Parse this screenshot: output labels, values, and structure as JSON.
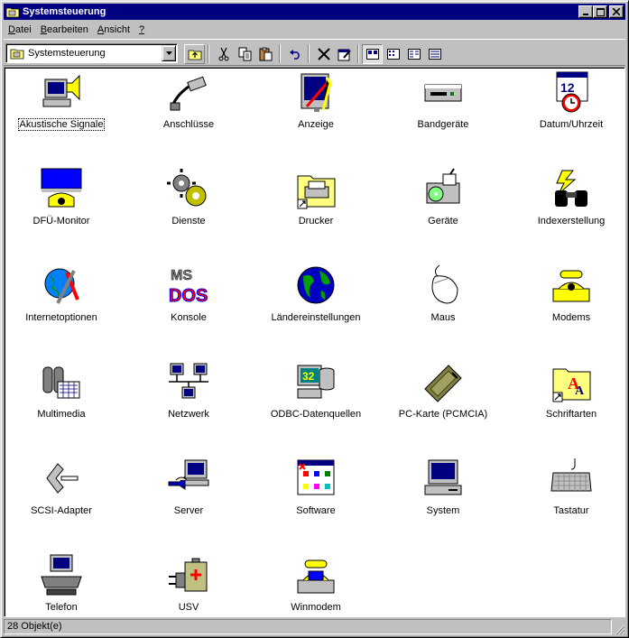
{
  "window": {
    "title": "Systemsteuerung"
  },
  "menu": [
    {
      "accel": "D",
      "rest": "atei"
    },
    {
      "accel": "B",
      "rest": "earbeiten"
    },
    {
      "accel": "A",
      "rest": "nsicht"
    },
    {
      "accel": "?",
      "rest": ""
    }
  ],
  "address": {
    "value": "Systemsteuerung"
  },
  "toolbar_buttons": [
    "up-folder",
    "cut",
    "copy",
    "paste",
    "undo",
    "delete",
    "properties",
    "large-icons",
    "small-icons",
    "list",
    "details"
  ],
  "items": [
    {
      "label": "Akustische Signale",
      "icon": "speaker-computer-icon"
    },
    {
      "label": "Anschlüsse",
      "icon": "port-cable-icon"
    },
    {
      "label": "Anzeige",
      "icon": "display-icon"
    },
    {
      "label": "Bandgeräte",
      "icon": "tape-drive-icon"
    },
    {
      "label": "Datum/Uhrzeit",
      "icon": "calendar-clock-icon"
    },
    {
      "label": "DFÜ-Monitor",
      "icon": "dialup-monitor-icon"
    },
    {
      "label": "Dienste",
      "icon": "gears-icon"
    },
    {
      "label": "Drucker",
      "icon": "printer-folder-icon"
    },
    {
      "label": "Geräte",
      "icon": "devices-icon"
    },
    {
      "label": "Indexerstellung",
      "icon": "binoculars-icon"
    },
    {
      "label": "Internetoptionen",
      "icon": "globe-tools-icon"
    },
    {
      "label": "Konsole",
      "icon": "msdos-icon"
    },
    {
      "label": "Ländereinstellungen",
      "icon": "globe-icon"
    },
    {
      "label": "Maus",
      "icon": "mouse-icon"
    },
    {
      "label": "Modems",
      "icon": "modem-phone-icon"
    },
    {
      "label": "Multimedia",
      "icon": "multimedia-icon"
    },
    {
      "label": "Netzwerk",
      "icon": "network-icon"
    },
    {
      "label": "ODBC-Datenquellen",
      "icon": "odbc-icon"
    },
    {
      "label": "PC-Karte (PCMCIA)",
      "icon": "pc-card-icon"
    },
    {
      "label": "Schriftarten",
      "icon": "fonts-folder-icon"
    },
    {
      "label": "SCSI-Adapter",
      "icon": "scsi-icon"
    },
    {
      "label": "Server",
      "icon": "server-icon"
    },
    {
      "label": "Software",
      "icon": "software-icon"
    },
    {
      "label": "System",
      "icon": "system-computer-icon"
    },
    {
      "label": "Tastatur",
      "icon": "keyboard-icon"
    },
    {
      "label": "Telefon",
      "icon": "telephony-icon"
    },
    {
      "label": "USV",
      "icon": "ups-battery-icon"
    },
    {
      "label": "Winmodem",
      "icon": "winmodem-icon"
    }
  ],
  "status": {
    "text": "28 Objekt(e)"
  }
}
